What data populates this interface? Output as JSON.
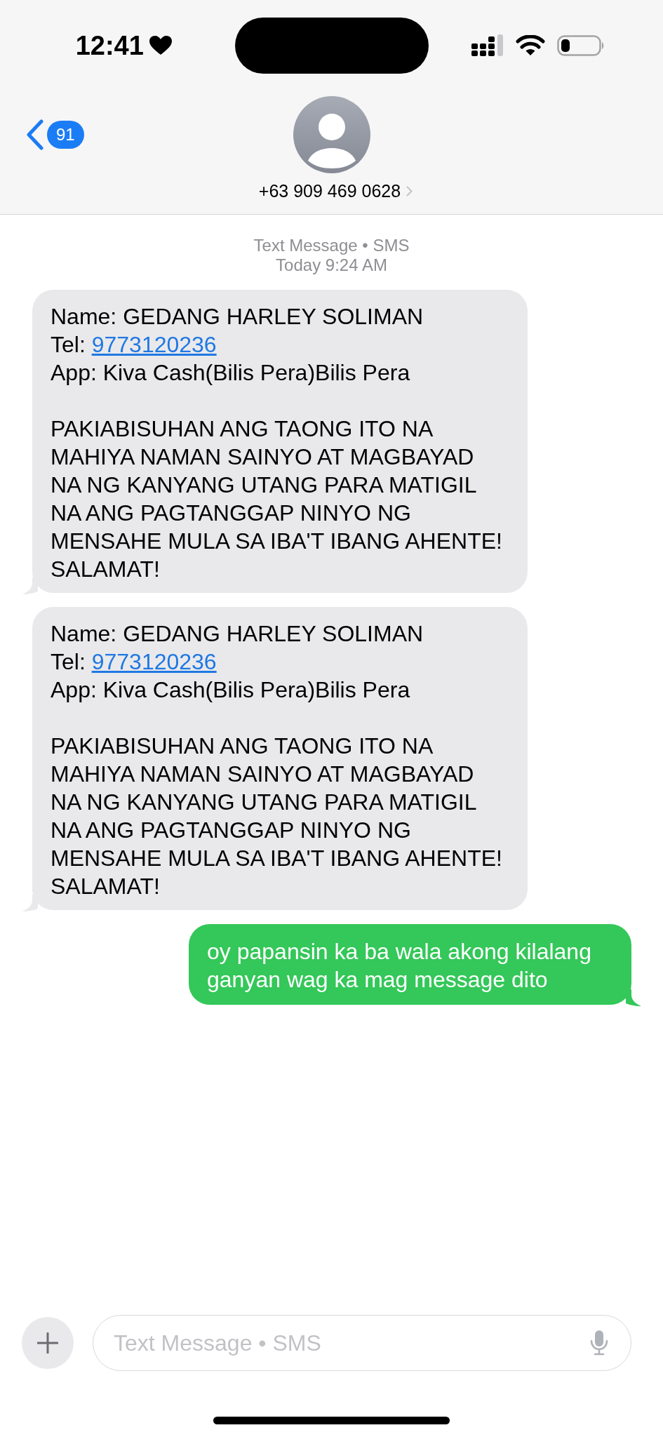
{
  "status_bar": {
    "time": "12:41"
  },
  "header": {
    "back_badge": "91",
    "contact": "+63 909 469 0628"
  },
  "thread_info": {
    "service": "Text Message • SMS",
    "timestamp": "Today 9:24 AM"
  },
  "messages": [
    {
      "kind": "incoming",
      "lines": [
        {
          "kind": "text",
          "text": "Name: GEDANG HARLEY SOLIMAN"
        },
        {
          "kind": "phone",
          "label": "Tel:",
          "number": "9773120236"
        },
        {
          "kind": "text",
          "text": "App: Kiva Cash(Bilis Pera)Bilis Pera"
        },
        {
          "kind": "paragraph",
          "text": "PAKIABISUHAN ANG TAONG ITO NA\nMAHIYA NAMAN SAINYO AT MAGBAYAD\nNA NG KANYANG UTANG PARA MATIGIL\nNA ANG PAGTANGGAP NINYO NG\nMENSAHE MULA SA IBA'T IBANG AHENTE!\nSALAMAT!"
        }
      ]
    },
    {
      "kind": "incoming",
      "lines": [
        {
          "kind": "text",
          "text": "Name: GEDANG HARLEY SOLIMAN"
        },
        {
          "kind": "phone",
          "label": "Tel:",
          "number": "9773120236"
        },
        {
          "kind": "text",
          "text": "App: Kiva Cash(Bilis Pera)Bilis Pera"
        },
        {
          "kind": "paragraph",
          "text": "PAKIABISUHAN ANG TAONG ITO NA\nMAHIYA NAMAN SAINYO AT MAGBAYAD\nNA NG KANYANG UTANG PARA MATIGIL\nNA ANG PAGTANGGAP NINYO NG\nMENSAHE MULA SA IBA'T IBANG AHENTE!\nSALAMAT!"
        }
      ]
    },
    {
      "kind": "outgoing",
      "lines": [
        {
          "kind": "text",
          "text": "oy papansin ka ba wala akong kilalang ganyan wag ka mag message dito"
        }
      ]
    }
  ],
  "composer": {
    "placeholder": "Text Message • SMS"
  }
}
